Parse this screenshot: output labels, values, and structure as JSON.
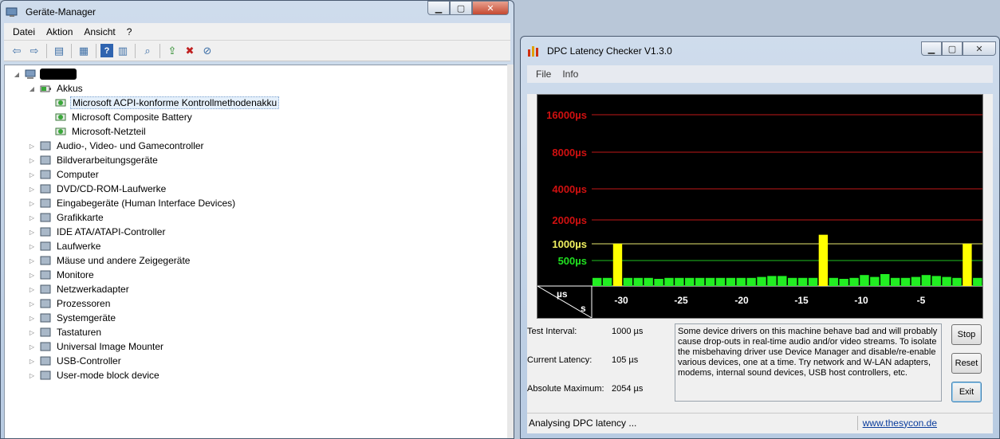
{
  "device_manager": {
    "title": "Geräte-Manager",
    "menu": [
      "Datei",
      "Aktion",
      "Ansicht",
      "?"
    ],
    "toolbar_icons": [
      "back-arrow-icon",
      "forward-arrow-icon",
      "show-hide-icon",
      "properties-icon",
      "help-icon",
      "view-icon",
      "scan-hardware-icon",
      "update-driver-icon",
      "uninstall-icon",
      "disable-icon"
    ],
    "tree": [
      {
        "label": "",
        "level": 0,
        "expander": "◢",
        "icon": "computer-icon",
        "redacted": true
      },
      {
        "label": "Akkus",
        "level": 1,
        "expander": "◢",
        "icon": "battery-icon"
      },
      {
        "label": "Microsoft ACPI-konforme Kontrollmethodenakku",
        "level": 2,
        "expander": "",
        "icon": "battery-device-icon",
        "selected": true
      },
      {
        "label": "Microsoft Composite Battery",
        "level": 2,
        "expander": "",
        "icon": "battery-device-icon"
      },
      {
        "label": "Microsoft-Netzteil",
        "level": 2,
        "expander": "",
        "icon": "battery-device-icon"
      },
      {
        "label": "Audio-, Video- und Gamecontroller",
        "level": 1,
        "expander": "▷",
        "icon": "speaker-icon"
      },
      {
        "label": "Bildverarbeitungsgeräte",
        "level": 1,
        "expander": "▷",
        "icon": "scanner-icon"
      },
      {
        "label": "Computer",
        "level": 1,
        "expander": "▷",
        "icon": "monitor-icon"
      },
      {
        "label": "DVD/CD-ROM-Laufwerke",
        "level": 1,
        "expander": "▷",
        "icon": "dvd-drive-icon"
      },
      {
        "label": "Eingabegeräte (Human Interface Devices)",
        "level": 1,
        "expander": "▷",
        "icon": "hid-icon"
      },
      {
        "label": "Grafikkarte",
        "level": 1,
        "expander": "▷",
        "icon": "display-adapter-icon"
      },
      {
        "label": "IDE ATA/ATAPI-Controller",
        "level": 1,
        "expander": "▷",
        "icon": "ide-controller-icon"
      },
      {
        "label": "Laufwerke",
        "level": 1,
        "expander": "▷",
        "icon": "disk-drive-icon"
      },
      {
        "label": "Mäuse und andere Zeigegeräte",
        "level": 1,
        "expander": "▷",
        "icon": "mouse-icon"
      },
      {
        "label": "Monitore",
        "level": 1,
        "expander": "▷",
        "icon": "monitor-icon"
      },
      {
        "label": "Netzwerkadapter",
        "level": 1,
        "expander": "▷",
        "icon": "network-adapter-icon"
      },
      {
        "label": "Prozessoren",
        "level": 1,
        "expander": "▷",
        "icon": "processor-icon"
      },
      {
        "label": "Systemgeräte",
        "level": 1,
        "expander": "▷",
        "icon": "system-device-icon"
      },
      {
        "label": "Tastaturen",
        "level": 1,
        "expander": "▷",
        "icon": "keyboard-icon"
      },
      {
        "label": "Universal Image Mounter",
        "level": 1,
        "expander": "▷",
        "icon": "image-mounter-icon"
      },
      {
        "label": "USB-Controller",
        "level": 1,
        "expander": "▷",
        "icon": "usb-icon"
      },
      {
        "label": "User-mode block device",
        "level": 1,
        "expander": "▷",
        "icon": "block-device-icon"
      }
    ]
  },
  "dpc": {
    "title": "DPC Latency Checker V1.3.0",
    "menu": [
      "File",
      "Info"
    ],
    "graph": {
      "y_labels": [
        {
          "text": "16000µs",
          "color": "#d01010"
        },
        {
          "text": "8000µs",
          "color": "#d01010"
        },
        {
          "text": "4000µs",
          "color": "#d01010"
        },
        {
          "text": "2000µs",
          "color": "#d01010"
        },
        {
          "text": "1000µs",
          "color": "#f0f060"
        },
        {
          "text": "500µs",
          "color": "#20e020"
        }
      ],
      "x_labels": [
        "-30",
        "-25",
        "-20",
        "-15",
        "-10",
        "-5"
      ],
      "corner_top": "µs",
      "corner_bottom": "s",
      "bars": [
        10,
        10,
        1000,
        10,
        10,
        10,
        9,
        10,
        10,
        10,
        10,
        10,
        10,
        10,
        10,
        10,
        11,
        12,
        12,
        10,
        10,
        10,
        1300,
        10,
        9,
        10,
        13,
        11,
        14,
        10,
        10,
        11,
        13,
        12,
        11,
        10,
        1000,
        10
      ],
      "colors": {
        "background": "#000000",
        "red_line": "#c01818",
        "yellow_line": "#e8e870",
        "green_line": "#20c020",
        "bar_green": "#22ee22",
        "bar_yellow": "#ffff00"
      }
    },
    "info": {
      "test_interval_label": "Test Interval:",
      "test_interval_value": "1000 µs",
      "current_latency_label": "Current Latency:",
      "current_latency_value": "105 µs",
      "absolute_max_label": "Absolute Maximum:",
      "absolute_max_value": "2054 µs"
    },
    "message": "Some device drivers on this machine behave bad and will probably cause drop-outs in real-time audio and/or video streams. To isolate the misbehaving driver use Device Manager and disable/re-enable various devices, one at a time. Try network and W-LAN adapters, modems, internal sound devices, USB host controllers, etc.",
    "buttons": {
      "stop": "Stop",
      "reset": "Reset",
      "exit": "Exit"
    },
    "status": "Analysing DPC latency ...",
    "link": "www.thesycon.de"
  }
}
